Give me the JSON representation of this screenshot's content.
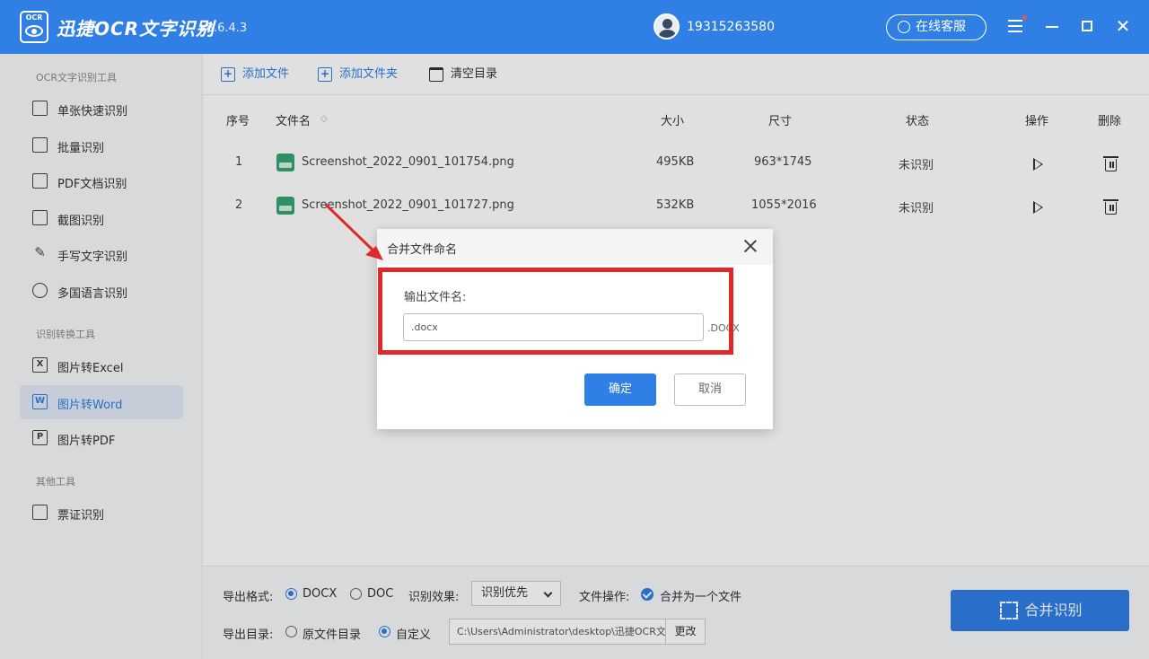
{
  "titlebar": {
    "logo_text": "OCR",
    "app_name": "迅捷OCR文字识别",
    "version": "v8.6.4.3",
    "username": "19315263580",
    "service_label": "在线客服"
  },
  "sidebar": {
    "categories": [
      "OCR文字识别工具",
      "识别转换工具",
      "其他工具"
    ],
    "items": [
      {
        "label": "单张快速识别"
      },
      {
        "label": "批量识别"
      },
      {
        "label": "PDF文档识别"
      },
      {
        "label": "截图识别"
      },
      {
        "label": "手写文字识别"
      },
      {
        "label": "多国语言识别"
      },
      {
        "label": "图片转Excel",
        "icon": "X"
      },
      {
        "label": "图片转Word",
        "icon": "W"
      },
      {
        "label": "图片转PDF",
        "icon": "P"
      },
      {
        "label": "票证识别"
      }
    ]
  },
  "toolbar": {
    "add_file": "添加文件",
    "add_folder": "添加文件夹",
    "clear": "清空目录"
  },
  "table": {
    "headers": {
      "index": "序号",
      "filename": "文件名",
      "size": "大小",
      "dimensions": "尺寸",
      "status": "状态",
      "action": "操作",
      "delete": "删除"
    },
    "rows": [
      {
        "index": "1",
        "filename": "Screenshot_2022_0901_101754.png",
        "size": "495KB",
        "dimensions": "963*1745",
        "status": "未识别"
      },
      {
        "index": "2",
        "filename": "Screenshot_2022_0901_101727.png",
        "size": "532KB",
        "dimensions": "1055*2016",
        "status": "未识别"
      }
    ]
  },
  "bottom": {
    "format_label": "导出格式:",
    "format_docx": "DOCX",
    "format_doc": "DOC",
    "effect_label": "识别效果:",
    "effect_value": "识别优先",
    "file_op_label": "文件操作:",
    "file_op_value": "合并为一个文件",
    "dir_label": "导出目录:",
    "dir_original": "原文件目录",
    "dir_custom": "自定义",
    "dir_path": "C:\\Users\\Administrator\\desktop\\迅捷OCR文",
    "change_label": "更改",
    "merge_label": "合并识别"
  },
  "dialog": {
    "title": "合并文件命名",
    "field_label": "输出文件名:",
    "input_value": ".docx",
    "ext": ".DOCX",
    "ok_label": "确定",
    "cancel_label": "取消"
  },
  "colors": {
    "accent": "#2f7fe5",
    "highlight": "#e02828"
  }
}
